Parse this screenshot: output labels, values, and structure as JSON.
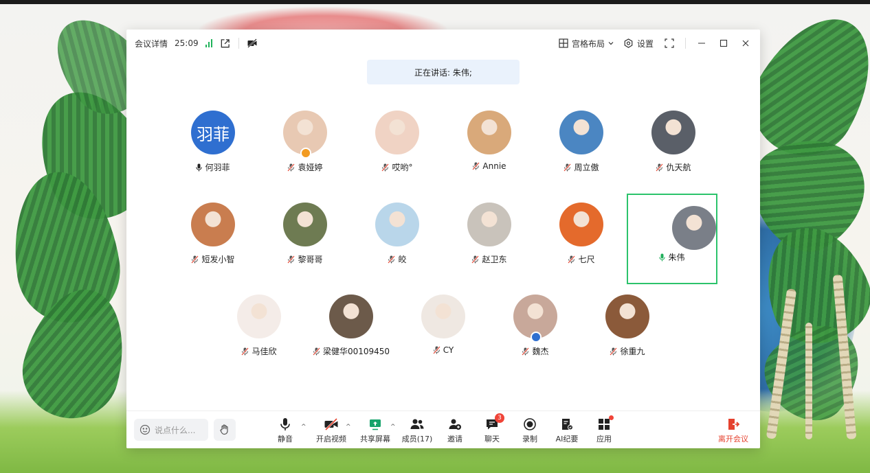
{
  "header": {
    "meeting_details": "会议详情",
    "timer": "25:09",
    "layout_label": "宫格布局",
    "settings_label": "设置"
  },
  "speaking": "正在讲话: 朱伟;",
  "participants": [
    {
      "name": "何羽菲",
      "initials": "羽菲",
      "avatar_color": "#2f6fd0",
      "mic": "on"
    },
    {
      "name": "袁娅婷",
      "avatar_color": "#e8c9b3",
      "mic": "muted",
      "badge": "host"
    },
    {
      "name": "哎哟°",
      "avatar_color": "#f0d3c4",
      "mic": "muted"
    },
    {
      "name": "Annie",
      "avatar_color": "#d9a97a",
      "mic": "muted"
    },
    {
      "name": "周立傲",
      "avatar_color": "#4b86c2",
      "mic": "muted"
    },
    {
      "name": "仇天航",
      "avatar_color": "#5a5f68",
      "mic": "muted"
    },
    {
      "name": "短发小智",
      "avatar_color": "#c97d4f",
      "mic": "muted"
    },
    {
      "name": "黎哥哥",
      "avatar_color": "#6e7b52",
      "mic": "muted"
    },
    {
      "name": "皎",
      "avatar_color": "#b9d6ea",
      "mic": "muted"
    },
    {
      "name": "赵卫东",
      "avatar_color": "#c9c3bb",
      "mic": "muted"
    },
    {
      "name": "七尺",
      "avatar_color": "#e46a2c",
      "mic": "muted"
    },
    {
      "name": "朱伟",
      "avatar_color": "#7a7f88",
      "mic": "speaking",
      "active": true
    },
    {
      "name": "马佳欣",
      "avatar_color": "#f4ece8",
      "mic": "muted"
    },
    {
      "name": "梁健华00109450",
      "avatar_color": "#6c5a4a",
      "mic": "muted"
    },
    {
      "name": "CY",
      "avatar_color": "#efe8e2",
      "mic": "muted"
    },
    {
      "name": "魏杰",
      "avatar_color": "#c8a89a",
      "mic": "muted",
      "badge": "cohost"
    },
    {
      "name": "徐重九",
      "avatar_color": "#8b5a3a",
      "mic": "muted"
    }
  ],
  "toolbar": {
    "chat_placeholder": "说点什么...",
    "mute_label": "静音",
    "video_label": "开启视频",
    "share_label": "共享屏幕",
    "members_label": "成员(17)",
    "invite_label": "邀请",
    "chat_label": "聊天",
    "chat_badge": "3",
    "record_label": "录制",
    "ai_label": "AI纪要",
    "apps_label": "应用",
    "leave_label": "离开会议"
  },
  "colors": {
    "accent_green": "#2bc36b",
    "signal_green": "#1fb35a",
    "leave_red": "#e5412e",
    "badge_red": "#f04438",
    "speaking_bg": "#eaf2fc"
  }
}
